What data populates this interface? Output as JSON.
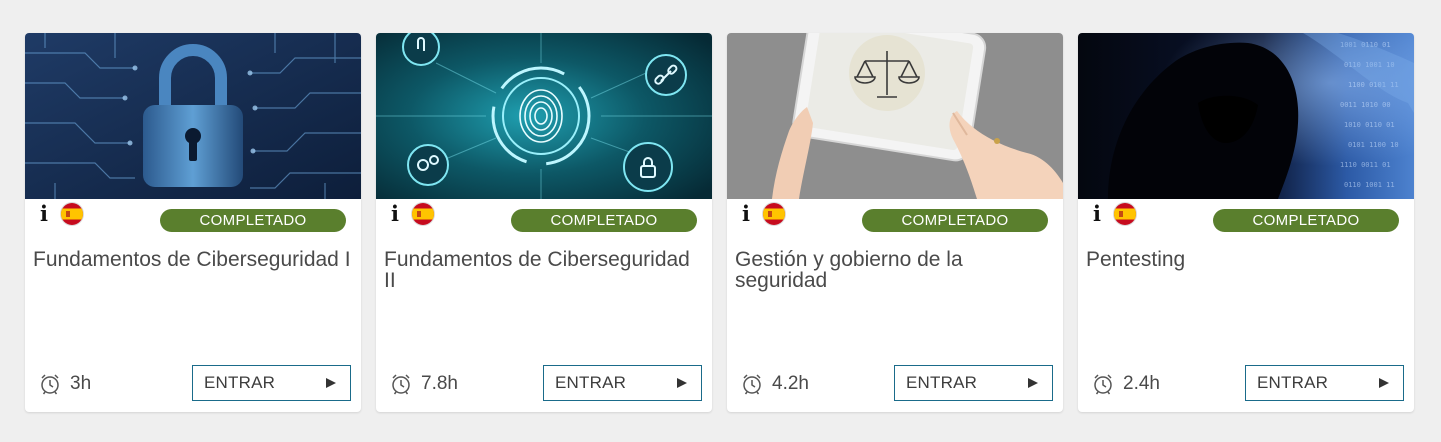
{
  "courses": [
    {
      "title": "Fundamentos de Ciberseguridad I",
      "status": "COMPLETADO",
      "duration": "3h",
      "action_label": "ENTRAR",
      "info_icon": "info-icon",
      "flag_icon": "spain-flag-icon",
      "image": "padlock-circuit-board"
    },
    {
      "title": "Fundamentos de Ciberseguridad II",
      "status": "COMPLETADO",
      "duration": "7.8h",
      "action_label": "ENTRAR",
      "info_icon": "info-icon",
      "flag_icon": "spain-flag-icon",
      "image": "fingerprint-security-icons"
    },
    {
      "title": "Gestión y gobierno de la seguridad",
      "status": "COMPLETADO",
      "duration": "4.2h",
      "action_label": "ENTRAR",
      "info_icon": "info-icon",
      "flag_icon": "spain-flag-icon",
      "image": "tablet-justice-scales"
    },
    {
      "title": "Pentesting",
      "status": "COMPLETADO",
      "duration": "2.4h",
      "action_label": "ENTRAR",
      "info_icon": "info-icon",
      "flag_icon": "spain-flag-icon",
      "image": "hooded-hacker-binary"
    }
  ],
  "colors": {
    "page_background": "#efefef",
    "badge_background": "#5a7f2d",
    "button_border": "#1a6b8a",
    "title_text": "#4a4a4a"
  }
}
